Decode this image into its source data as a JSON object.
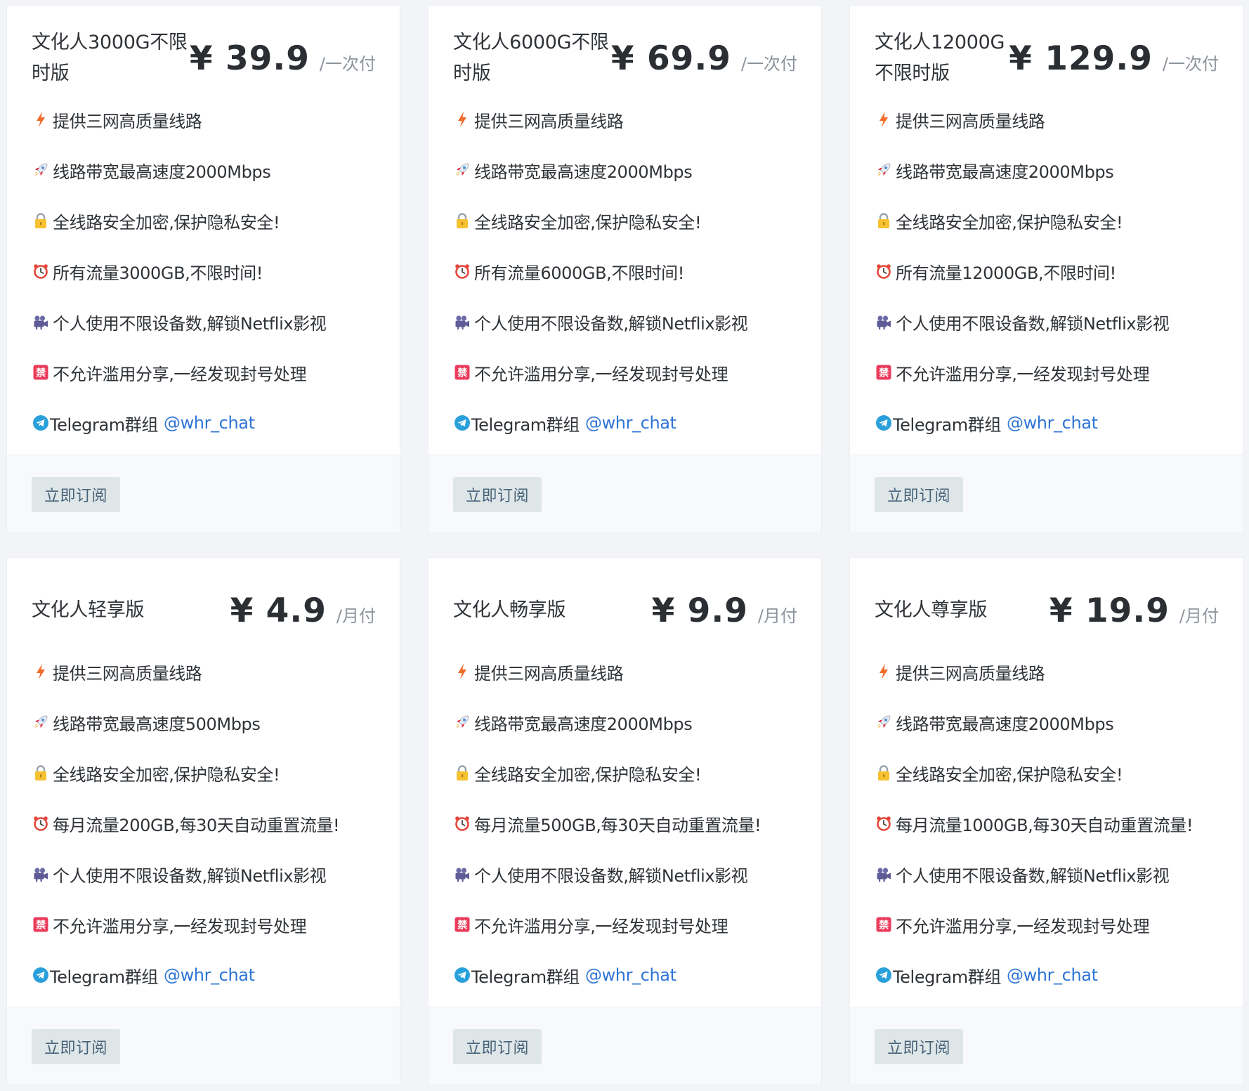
{
  "plans": [
    {
      "name": "文化人3000G不限时版",
      "price": "¥ 39.9",
      "period": "/一次付",
      "features": [
        "提供三网高质量线路",
        "线路带宽最高速度2000Mbps",
        "全线路安全加密,保护隐私安全!",
        "所有流量3000GB,不限时间!",
        "个人使用不限设备数,解锁Netflix影视",
        "不允许滥用分享,一经发现封号处理"
      ],
      "telegram_label": "Telegram群组",
      "telegram_link": "@whr_chat",
      "button": "立即订阅"
    },
    {
      "name": "文化人6000G不限时版",
      "price": "¥ 69.9",
      "period": "/一次付",
      "features": [
        "提供三网高质量线路",
        "线路带宽最高速度2000Mbps",
        "全线路安全加密,保护隐私安全!",
        "所有流量6000GB,不限时间!",
        "个人使用不限设备数,解锁Netflix影视",
        "不允许滥用分享,一经发现封号处理"
      ],
      "telegram_label": "Telegram群组",
      "telegram_link": "@whr_chat",
      "button": "立即订阅"
    },
    {
      "name": "文化人12000G不限时版",
      "price": "¥ 129.9",
      "period": "/一次付",
      "features": [
        "提供三网高质量线路",
        "线路带宽最高速度2000Mbps",
        "全线路安全加密,保护隐私安全!",
        "所有流量12000GB,不限时间!",
        "个人使用不限设备数,解锁Netflix影视",
        "不允许滥用分享,一经发现封号处理"
      ],
      "telegram_label": "Telegram群组",
      "telegram_link": "@whr_chat",
      "button": "立即订阅"
    },
    {
      "name": "文化人轻享版",
      "price": "¥ 4.9",
      "period": "/月付",
      "features": [
        "提供三网高质量线路",
        "线路带宽最高速度500Mbps",
        "全线路安全加密,保护隐私安全!",
        "每月流量200GB,每30天自动重置流量!",
        "个人使用不限设备数,解锁Netflix影视",
        "不允许滥用分享,一经发现封号处理"
      ],
      "telegram_label": "Telegram群组",
      "telegram_link": "@whr_chat",
      "button": "立即订阅"
    },
    {
      "name": "文化人畅享版",
      "price": "¥ 9.9",
      "period": "/月付",
      "features": [
        "提供三网高质量线路",
        "线路带宽最高速度2000Mbps",
        "全线路安全加密,保护隐私安全!",
        "每月流量500GB,每30天自动重置流量!",
        "个人使用不限设备数,解锁Netflix影视",
        "不允许滥用分享,一经发现封号处理"
      ],
      "telegram_label": "Telegram群组",
      "telegram_link": "@whr_chat",
      "button": "立即订阅"
    },
    {
      "name": "文化人尊享版",
      "price": "¥ 19.9",
      "period": "/月付",
      "features": [
        "提供三网高质量线路",
        "线路带宽最高速度2000Mbps",
        "全线路安全加密,保护隐私安全!",
        "每月流量1000GB,每30天自动重置流量!",
        "个人使用不限设备数,解锁Netflix影视",
        "不允许滥用分享,一经发现封号处理"
      ],
      "telegram_label": "Telegram群组",
      "telegram_link": "@whr_chat",
      "button": "立即订阅"
    }
  ],
  "feature_icons": [
    "lightning-icon",
    "rocket-icon",
    "lock-icon",
    "alarm-clock-icon",
    "video-camera-icon",
    "prohibited-sign-icon"
  ],
  "telegram_icon": "telegram-icon",
  "colors": {
    "page_bg": "#f3f4f8",
    "card_bg": "#ffffff",
    "footer_bg": "#f8f9fb",
    "button_bg": "#dfe6e8",
    "button_text": "#47637a",
    "link": "#2f75d6",
    "period_text": "#8d949c"
  }
}
